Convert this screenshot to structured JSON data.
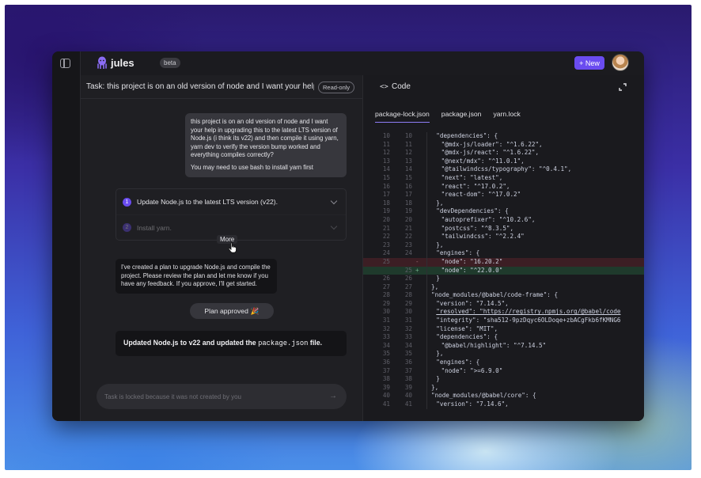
{
  "app": {
    "brand": "jules",
    "badge": "beta",
    "new_button": "+ New"
  },
  "task": {
    "title": "Task: this project is on an old version of node and I want your help in",
    "readonly_badge": "Read-only"
  },
  "chat": {
    "user_message": {
      "paragraph1": "this project is on an old version of node and I want your help in upgrading this to the latest LTS version of Node.js (i think its v22) and then compile it using yarn, yarn dev to verify the version bump worked and everything compiles correctly?",
      "paragraph2": "You may need to use bash to install yarn first"
    },
    "plan": {
      "steps": [
        {
          "num": "1",
          "text": "Update Node.js to the latest LTS version (v22)."
        },
        {
          "num": "2",
          "text": "Install yarn."
        }
      ],
      "more_label": "More"
    },
    "agent_message": "I've created a plan to upgrade Node.js and compile the project. Please review the plan and let me know if you have any feedback. If you approve, I'll get started.",
    "approved_label": "Plan approved",
    "approved_emoji": "🎉",
    "result": {
      "prefix": "Updated Node.js to v22 and updated the ",
      "code": "package.json",
      "suffix": " file."
    },
    "input_placeholder": "Task is locked because it was not created by you",
    "send_icon": "arrow-right-icon"
  },
  "code_panel": {
    "title": "Code",
    "tabs": [
      "package-lock.json",
      "package.json",
      "yarn.lock"
    ],
    "active_tab": 0,
    "lines": [
      {
        "a": "10",
        "b": "10",
        "t": "\"dependencies\": {",
        "i": 2
      },
      {
        "a": "11",
        "b": "11",
        "t": "\"@mdx-js/loader\": \"^1.6.22\",",
        "i": 3
      },
      {
        "a": "12",
        "b": "12",
        "t": "\"@mdx-js/react\": \"^1.6.22\",",
        "i": 3
      },
      {
        "a": "13",
        "b": "13",
        "t": "\"@next/mdx\": \"^11.0.1\",",
        "i": 3
      },
      {
        "a": "14",
        "b": "14",
        "t": "\"@tailwindcss/typography\": \"^0.4.1\",",
        "i": 3
      },
      {
        "a": "15",
        "b": "15",
        "t": "\"next\": \"latest\",",
        "i": 3
      },
      {
        "a": "16",
        "b": "16",
        "t": "\"react\": \"^17.0.2\",",
        "i": 3
      },
      {
        "a": "17",
        "b": "17",
        "t": "\"react-dom\": \"^17.0.2\"",
        "i": 3
      },
      {
        "a": "18",
        "b": "18",
        "t": "},",
        "i": 2
      },
      {
        "a": "19",
        "b": "19",
        "t": "\"devDependencies\": {",
        "i": 2
      },
      {
        "a": "20",
        "b": "20",
        "t": "\"autoprefixer\": \"^10.2.6\",",
        "i": 3
      },
      {
        "a": "21",
        "b": "21",
        "t": "\"postcss\": \"^8.3.5\",",
        "i": 3
      },
      {
        "a": "22",
        "b": "22",
        "t": "\"tailwindcss\": \"^2.2.4\"",
        "i": 3
      },
      {
        "a": "23",
        "b": "23",
        "t": "},",
        "i": 2
      },
      {
        "a": "24",
        "b": "24",
        "t": "\"engines\": {",
        "i": 2
      },
      {
        "a": "25",
        "b": "",
        "s": "-",
        "t": "\"node\": \"16.20.2\"",
        "i": 3,
        "type": "del"
      },
      {
        "a": "",
        "b": "25",
        "s": "+",
        "t": "\"node\": \"^22.0.0\"",
        "i": 3,
        "type": "add"
      },
      {
        "a": "26",
        "b": "26",
        "t": "}",
        "i": 2
      },
      {
        "a": "27",
        "b": "27",
        "t": "},",
        "i": 1
      },
      {
        "a": "28",
        "b": "28",
        "t": "\"node_modules/@babel/code-frame\": {",
        "i": 1
      },
      {
        "a": "29",
        "b": "29",
        "t": "\"version\": \"7.14.5\",",
        "i": 2
      },
      {
        "a": "30",
        "b": "30",
        "t": "\"resolved\": \"https://registry.npmjs.org/@babel/code",
        "i": 2
      },
      {
        "a": "31",
        "b": "31",
        "t": "\"integrity\": \"sha512-9pzDqyc6OLDoqe+zbACgFkb6fKMNG6",
        "i": 2
      },
      {
        "a": "32",
        "b": "32",
        "t": "\"license\": \"MIT\",",
        "i": 2
      },
      {
        "a": "33",
        "b": "33",
        "t": "\"dependencies\": {",
        "i": 2
      },
      {
        "a": "34",
        "b": "34",
        "t": "\"@babel/highlight\": \"^7.14.5\"",
        "i": 3
      },
      {
        "a": "35",
        "b": "35",
        "t": "},",
        "i": 2
      },
      {
        "a": "36",
        "b": "36",
        "t": "\"engines\": {",
        "i": 2
      },
      {
        "a": "37",
        "b": "37",
        "t": "\"node\": \">=6.9.0\"",
        "i": 3
      },
      {
        "a": "38",
        "b": "38",
        "t": "}",
        "i": 2
      },
      {
        "a": "39",
        "b": "39",
        "t": "},",
        "i": 1
      },
      {
        "a": "40",
        "b": "40",
        "t": "\"node_modules/@babel/core\": {",
        "i": 1
      },
      {
        "a": "41",
        "b": "41",
        "t": "\"version\": \"7.14.6\",",
        "i": 2
      }
    ]
  },
  "colors": {
    "accent": "#6a4cf0",
    "deleted_line": "#3c1e24",
    "added_line": "#1f3a2c"
  }
}
